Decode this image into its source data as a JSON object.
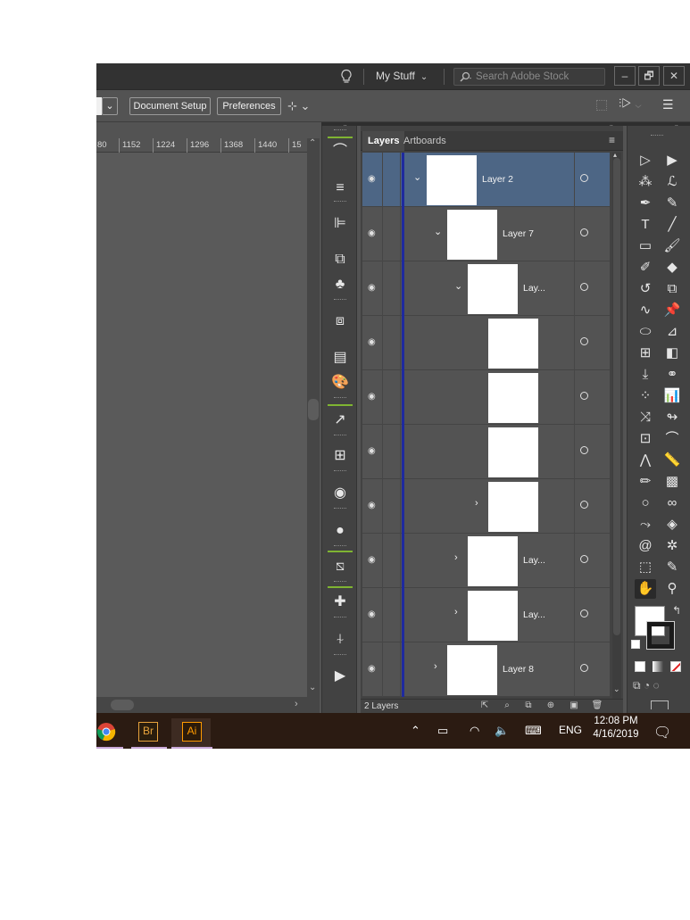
{
  "titlebar": {
    "workspace_label": "My Stuff",
    "search_placeholder": "Search Adobe Stock",
    "minimize": "–",
    "restore": "🗗",
    "close": "✕"
  },
  "controlbar": {
    "document_setup_label": "Document Setup",
    "preferences_label": "Preferences"
  },
  "ruler": {
    "ticks": [
      "80",
      "1152",
      "1224",
      "1296",
      "1368",
      "1440",
      "15"
    ]
  },
  "layers_panel": {
    "tabs": [
      {
        "label": "Layers",
        "active": true
      },
      {
        "label": "Artboards",
        "active": false
      }
    ],
    "rows": [
      {
        "name": "Layer 2",
        "depth": 0,
        "caret": "⌄",
        "selected": true
      },
      {
        "name": "Layer 7",
        "depth": 1,
        "caret": "⌄",
        "selected": false
      },
      {
        "name": "Lay...",
        "depth": 2,
        "caret": "⌄",
        "selected": false
      },
      {
        "name": "",
        "depth": 3,
        "caret": "",
        "selected": false
      },
      {
        "name": "",
        "depth": 3,
        "caret": "",
        "selected": false
      },
      {
        "name": "",
        "depth": 3,
        "caret": "",
        "selected": false
      },
      {
        "name": "",
        "depth": 3,
        "caret": "›",
        "selected": false
      },
      {
        "name": "Lay...",
        "depth": 2,
        "caret": "›",
        "selected": false
      },
      {
        "name": "Lay...",
        "depth": 2,
        "caret": "›",
        "selected": false
      },
      {
        "name": "Layer 8",
        "depth": 1,
        "caret": "›",
        "selected": false
      }
    ],
    "footer_count": "2 Layers",
    "scroll_position_fraction": 0.02
  },
  "taskbar": {
    "apps": [
      "chrome-icon",
      "Br",
      "Ai"
    ],
    "language": "ENG",
    "time": "12:08 PM",
    "date": "4/16/2019"
  },
  "colors": {
    "ui_dark": "#323232",
    "ui_mid": "#535353",
    "panel": "#424242",
    "selected_row": "#4d6685",
    "layer_color_bar": "#1e2a9e",
    "taskbar": "#2b1b12",
    "bridge_accent": "#e8a33c",
    "illustrator_accent": "#ff9a00"
  }
}
